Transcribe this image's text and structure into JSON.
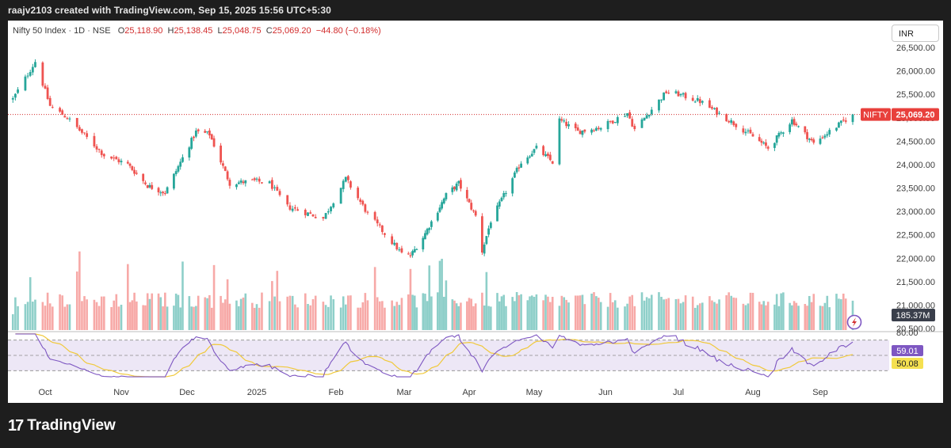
{
  "header": {
    "caption": "raajv2103 created with TradingView.com, Sep 15, 2025 15:56 UTC+5:30"
  },
  "legend": {
    "symbol": "Nifty 50 Index",
    "interval": "1D",
    "exchange": "NSE",
    "open_label": "O",
    "open": "25,118.90",
    "high_label": "H",
    "high": "25,138.45",
    "low_label": "L",
    "low": "25,048.75",
    "close_label": "C",
    "close": "25,069.20",
    "change": "−44.80 (−0.18%)"
  },
  "currency_button": "INR",
  "price_tag": {
    "symbol": "NIFTY",
    "value": "25,069.20"
  },
  "volume_tag": "185.37M",
  "rsi_tags": {
    "rsi": "59.01",
    "ma": "50.08"
  },
  "branding": {
    "logo_mark": "17",
    "name": "TradingView"
  },
  "colors": {
    "up": "#26a69a",
    "down": "#ef5350",
    "vol_up": "#8ecfc9",
    "vol_down": "#f7a9a7",
    "rsi_line": "#7e57c2",
    "rsi_ma": "#f0c93b",
    "rsi_band": "#ede7f6",
    "price_line": "#d32f2f",
    "tag_red": "#e8403c",
    "tag_purple": "#7e57c2",
    "tag_yellow": "#f5e050"
  },
  "chart_data": [
    {
      "type": "candlestick",
      "title": "Nifty 50 Index · 1D · NSE",
      "y_ticks": [
        "26,500.00",
        "26,000.00",
        "25,500.00",
        "25,000.00",
        "24,500.00",
        "24,000.00",
        "23,500.00",
        "23,000.00",
        "22,500.00",
        "22,000.00",
        "21,500.00",
        "21,000.00",
        "20,500.00"
      ],
      "ylim": [
        20500,
        26500
      ],
      "x_labels": [
        "Oct",
        "Nov",
        "Dec",
        "2025",
        "Feb",
        "Mar",
        "Apr",
        "May",
        "Jun",
        "Jul",
        "Aug",
        "Sep"
      ],
      "last_close": 25069.2,
      "path_keypoints": [
        {
          "date": "2024-09-18",
          "close": 25400
        },
        {
          "date": "2024-09-27",
          "close": 26200
        },
        {
          "date": "2024-10-03",
          "close": 25250
        },
        {
          "date": "2024-10-10",
          "close": 25000
        },
        {
          "date": "2024-10-25",
          "close": 24200
        },
        {
          "date": "2024-11-04",
          "close": 24000
        },
        {
          "date": "2024-11-13",
          "close": 23550
        },
        {
          "date": "2024-11-21",
          "close": 23400
        },
        {
          "date": "2024-12-05",
          "close": 24700
        },
        {
          "date": "2024-12-11",
          "close": 24650
        },
        {
          "date": "2024-12-20",
          "close": 23600
        },
        {
          "date": "2024-12-31",
          "close": 23650
        },
        {
          "date": "2025-01-06",
          "close": 23600
        },
        {
          "date": "2025-01-13",
          "close": 23100
        },
        {
          "date": "2025-01-27",
          "close": 22850
        },
        {
          "date": "2025-02-05",
          "close": 23700
        },
        {
          "date": "2025-02-14",
          "close": 22950
        },
        {
          "date": "2025-02-28",
          "close": 22100
        },
        {
          "date": "2025-03-04",
          "close": 22050
        },
        {
          "date": "2025-03-10",
          "close": 22450
        },
        {
          "date": "2025-03-21",
          "close": 23350
        },
        {
          "date": "2025-03-27",
          "close": 23600
        },
        {
          "date": "2025-04-04",
          "close": 22900
        },
        {
          "date": "2025-04-07",
          "close": 22150
        },
        {
          "date": "2025-04-11",
          "close": 22800
        },
        {
          "date": "2025-04-25",
          "close": 24050
        },
        {
          "date": "2025-05-02",
          "close": 24350
        },
        {
          "date": "2025-05-09",
          "close": 24050
        },
        {
          "date": "2025-05-12",
          "close": 24950
        },
        {
          "date": "2025-05-20",
          "close": 24700
        },
        {
          "date": "2025-05-30",
          "close": 24800
        },
        {
          "date": "2025-06-10",
          "close": 25100
        },
        {
          "date": "2025-06-13",
          "close": 24750
        },
        {
          "date": "2025-06-26",
          "close": 25550
        },
        {
          "date": "2025-07-01",
          "close": 25500
        },
        {
          "date": "2025-07-10",
          "close": 25350
        },
        {
          "date": "2025-07-25",
          "close": 24850
        },
        {
          "date": "2025-08-08",
          "close": 24350
        },
        {
          "date": "2025-08-19",
          "close": 24950
        },
        {
          "date": "2025-08-29",
          "close": 24450
        },
        {
          "date": "2025-09-15",
          "close": 25069.2
        }
      ]
    },
    {
      "type": "bar",
      "title": "Volume",
      "last_value": "185.37M"
    },
    {
      "type": "line",
      "title": "RSI",
      "levels": [
        70,
        50,
        30
      ],
      "ylim": [
        20,
        80
      ],
      "y_ticks": [
        "80.00"
      ],
      "series": [
        {
          "name": "RSI",
          "last": 59.01
        },
        {
          "name": "MA",
          "last": 50.08
        }
      ]
    }
  ]
}
